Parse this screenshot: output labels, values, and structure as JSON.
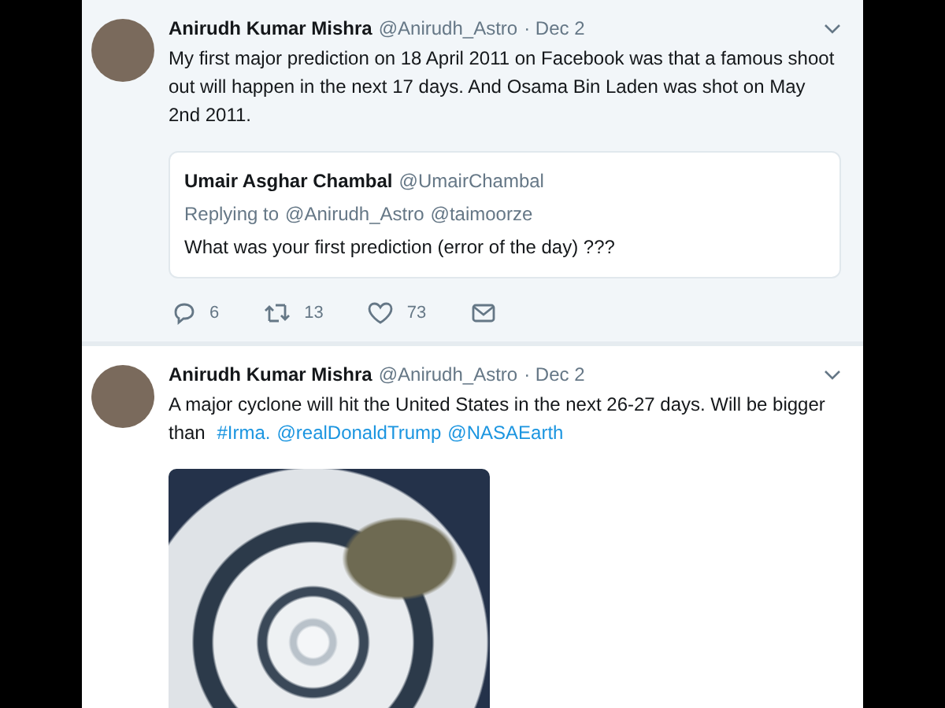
{
  "tweets": [
    {
      "author": "Anirudh Kumar Mishra",
      "handle": "@Anirudh_Astro",
      "time": "· Dec 2",
      "highlighted": true,
      "text": [
        {
          "kind": "plain",
          "text": "My first major prediction on 18 April 2011 on Facebook was that a famous shoot out will happen in the next 17 days. And Osama Bin Laden was shot on May 2nd 2011."
        }
      ],
      "quote": {
        "author": "Umair Asghar Chambal",
        "handle": "@UmairChambal",
        "replying_label": "Replying to",
        "replying_to": [
          "@Anirudh_Astro",
          "@taimoorze"
        ],
        "text": "What was your first prediction (error of the day) ???"
      },
      "actions": [
        {
          "kind": "reply",
          "count": "6"
        },
        {
          "kind": "retweet",
          "count": "13"
        },
        {
          "kind": "like",
          "count": "73"
        },
        {
          "kind": "message"
        }
      ]
    },
    {
      "author": "Anirudh Kumar Mishra",
      "handle": "@Anirudh_Astro",
      "time": "· Dec 2",
      "highlighted": false,
      "text": [
        {
          "kind": "plain",
          "text": "A major cyclone will hit the United States in the next 26-27 days. Will be bigger than "
        },
        {
          "kind": "hashtag",
          "text": "#Irma."
        },
        {
          "kind": "mention",
          "text": "@realDonaldTrump"
        },
        {
          "kind": "mention",
          "text": "@NASAEarth"
        }
      ],
      "media": {
        "kind": "photo"
      }
    }
  ]
}
